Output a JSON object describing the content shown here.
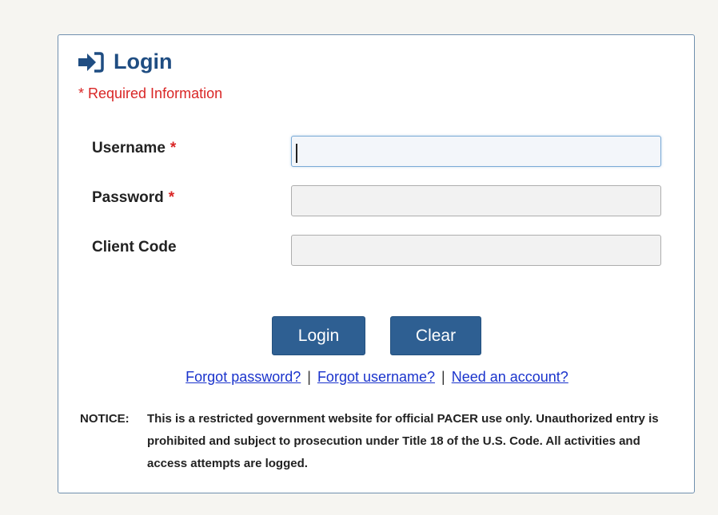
{
  "login": {
    "title": "Login",
    "required_note": "* Required Information",
    "fields": {
      "username": {
        "label": "Username",
        "required_mark": "*",
        "value": ""
      },
      "password": {
        "label": "Password",
        "required_mark": "*",
        "value": ""
      },
      "client_code": {
        "label": "Client Code",
        "value": ""
      }
    },
    "buttons": {
      "login": "Login",
      "clear": "Clear"
    },
    "links": {
      "forgot_password": "Forgot password?",
      "forgot_username": "Forgot username?",
      "need_account": "Need an account?",
      "separator": "|"
    },
    "notice": {
      "label": "NOTICE:",
      "text": "This is a restricted government website for official PACER use only. Unauthorized entry is prohibited and subject to prosecution under Title 18 of the U.S. Code. All activities and access attempts are logged."
    }
  },
  "icons": {
    "header": "sign-in-arrow-icon"
  },
  "colors": {
    "accent": "#2e5f92",
    "title": "#1f4d82",
    "required": "#d92626",
    "link": "#1a33cc"
  }
}
